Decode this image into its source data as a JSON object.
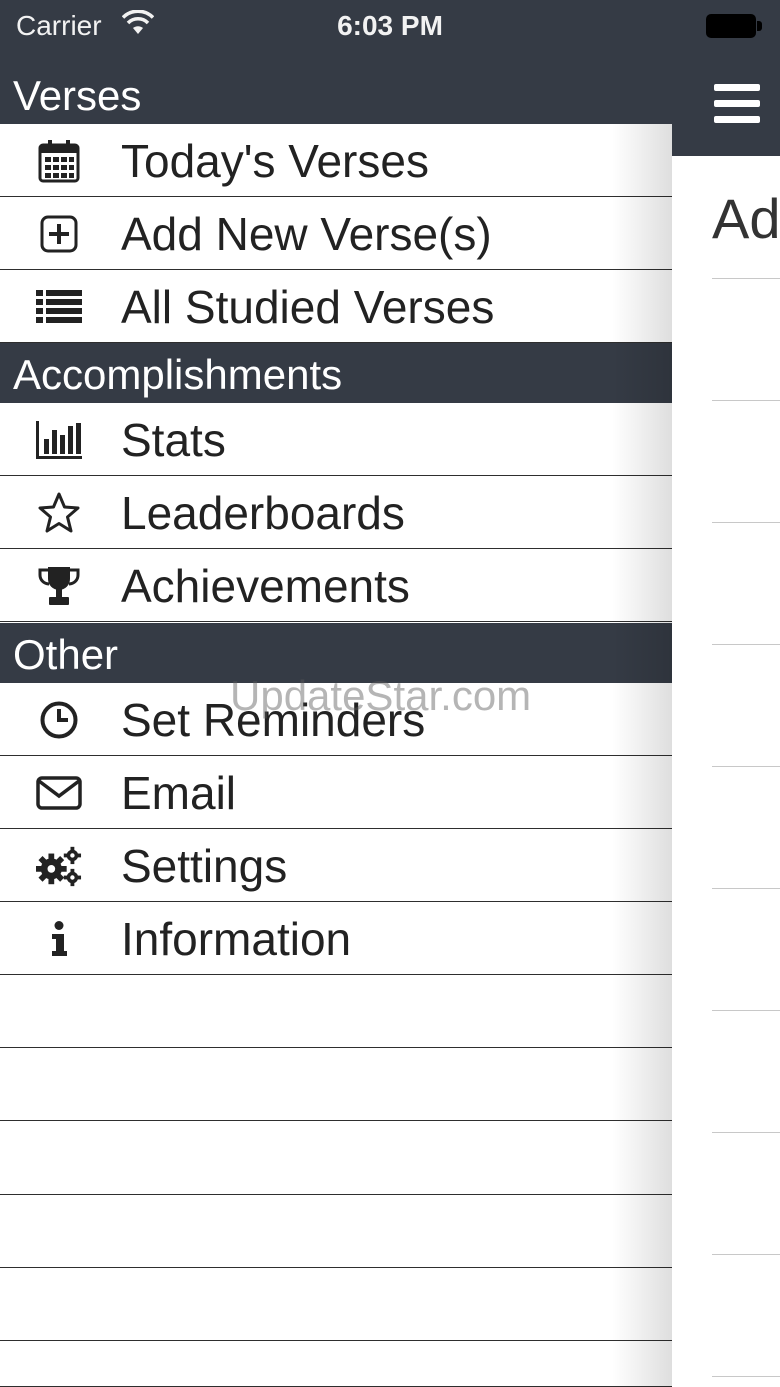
{
  "status_bar": {
    "carrier": "Carrier",
    "time": "6:03 PM"
  },
  "drawer": {
    "sections": [
      {
        "title": "Verses",
        "items": [
          {
            "label": "Today's Verses",
            "icon": "calendar-icon"
          },
          {
            "label": "Add New Verse(s)",
            "icon": "plus-square-icon"
          },
          {
            "label": "All Studied Verses",
            "icon": "list-icon"
          }
        ]
      },
      {
        "title": "Accomplishments",
        "items": [
          {
            "label": "Stats",
            "icon": "bar-chart-icon"
          },
          {
            "label": "Leaderboards",
            "icon": "star-icon"
          },
          {
            "label": "Achievements",
            "icon": "trophy-icon"
          }
        ]
      },
      {
        "title": "Other",
        "items": [
          {
            "label": "Set Reminders",
            "icon": "clock-icon"
          },
          {
            "label": "Email",
            "icon": "envelope-icon"
          },
          {
            "label": "Settings",
            "icon": "gears-icon"
          },
          {
            "label": "Information",
            "icon": "info-icon"
          }
        ]
      }
    ]
  },
  "main": {
    "title_partial": "Ad"
  },
  "watermark": "UpdateStar.com",
  "colors": {
    "nav_bg": "#353b45",
    "drawer_bg": "#ffffff",
    "text": "#222222"
  }
}
